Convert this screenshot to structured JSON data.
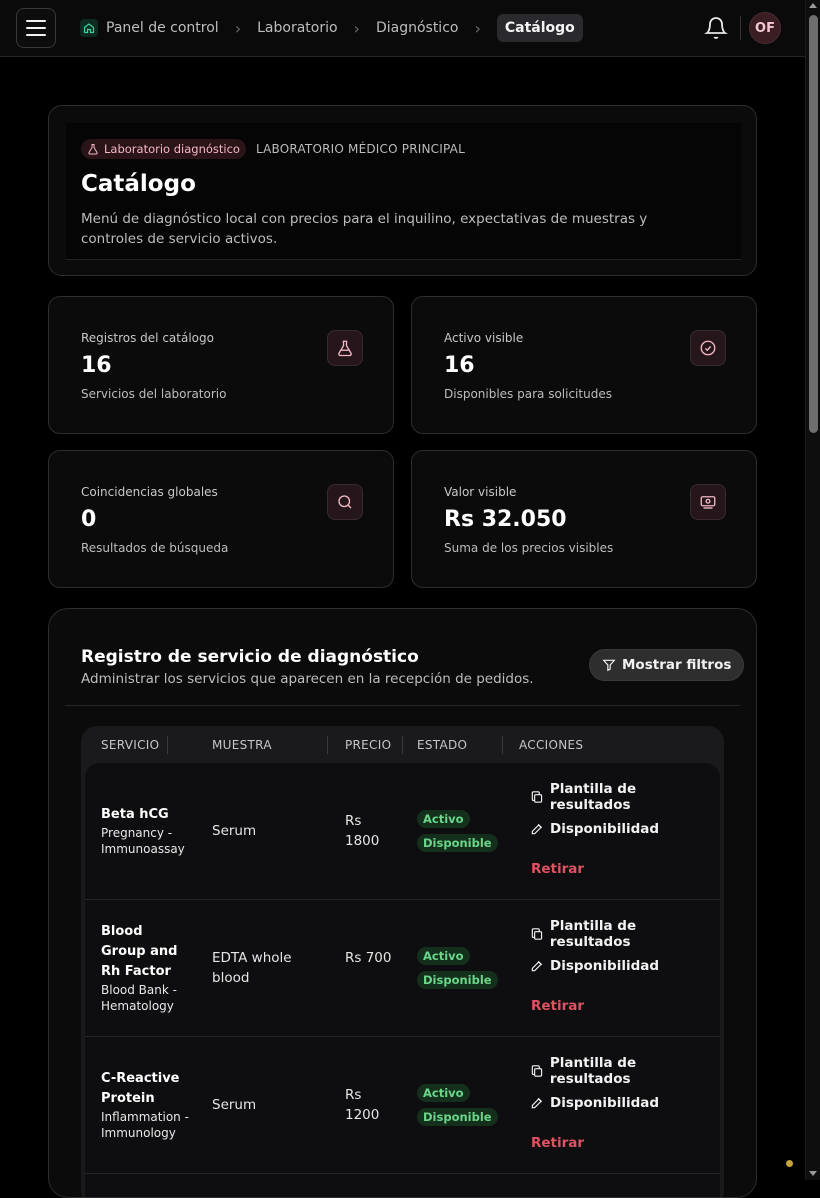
{
  "breadcrumb": [
    "Panel de control",
    "Laboratorio",
    "Diagnóstico",
    "Catálogo"
  ],
  "user": {
    "initials": "OF"
  },
  "header": {
    "tag": "Laboratorio diagnóstico",
    "org": "LABORATORIO MÉDICO PRINCIPAL",
    "title": "Catálogo",
    "description": "Menú de diagnóstico local con precios para el inquilino, expectativas de muestras y controles de servicio activos."
  },
  "stats": [
    {
      "label": "Registros del catálogo",
      "value": "16",
      "sub": "Servicios del laboratorio",
      "icon": "flask-icon"
    },
    {
      "label": "Activo visible",
      "value": "16",
      "sub": "Disponibles para solicitudes",
      "icon": "check-circle-icon"
    },
    {
      "label": "Coincidencias globales",
      "value": "0",
      "sub": "Resultados de búsqueda",
      "icon": "search-icon"
    },
    {
      "label": "Valor visible",
      "value": "Rs 32.050",
      "sub": "Suma de los precios visibles",
      "icon": "money-icon"
    }
  ],
  "registry": {
    "title": "Registro de servicio de diagnóstico",
    "subtitle": "Administrar los servicios que aparecen en la recepción de pedidos.",
    "filter_button": "Mostrar filtros"
  },
  "table": {
    "columns": [
      "SERVICIO",
      "MUESTRA",
      "PRECIO",
      "ESTADO",
      "ACCIONES"
    ],
    "rows": [
      {
        "name": "Beta hCG",
        "category": "Pregnancy - Immunoassay",
        "sample": "Serum",
        "price": "Rs 1800",
        "status": "Activo",
        "availability": "Disponible"
      },
      {
        "name": "Blood Group and Rh Factor",
        "category": "Blood Bank - Hematology",
        "sample": "EDTA whole blood",
        "price": "Rs 700",
        "status": "Activo",
        "availability": "Disponible"
      },
      {
        "name": "C-Reactive Protein",
        "category": "Inflammation - Immunology",
        "sample": "Serum",
        "price": "Rs 1200",
        "status": "Activo",
        "availability": "Disponible"
      }
    ],
    "actions": {
      "template": "Plantilla de resultados",
      "availability": "Disponibilidad",
      "retire": "Retirar"
    }
  },
  "colors": {
    "accent": "#f4b8c5",
    "success": "#6bd68b",
    "danger": "#e05262",
    "background": "#000000"
  }
}
